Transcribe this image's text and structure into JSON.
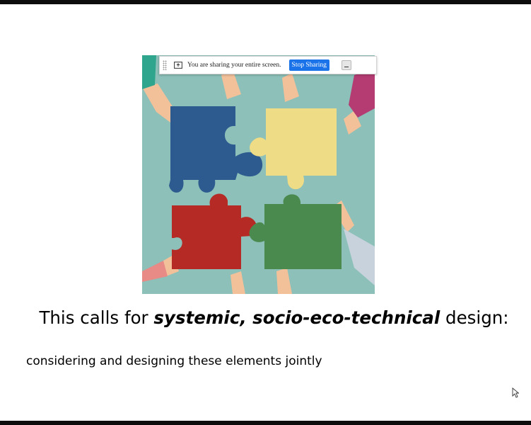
{
  "share_bar": {
    "message": "You are sharing your entire screen.",
    "stop_label": "Stop Sharing",
    "icon": "screen-share-icon",
    "minimize_icon": "minimize-icon"
  },
  "slide": {
    "title_prefix": "This calls for ",
    "title_emphasis": "systemic, socio-eco-technical",
    "title_suffix": " design:",
    "subtitle": "considering and designing these elements jointly"
  },
  "illustration": {
    "subject": "four-hands-puzzle-pieces",
    "colors": {
      "background": "#8cc0b8",
      "blue": "#2e5b8f",
      "yellow": "#efdc86",
      "red": "#b62a26",
      "green": "#4b8a4f"
    }
  },
  "colors": {
    "accent": "#1a73e8"
  }
}
